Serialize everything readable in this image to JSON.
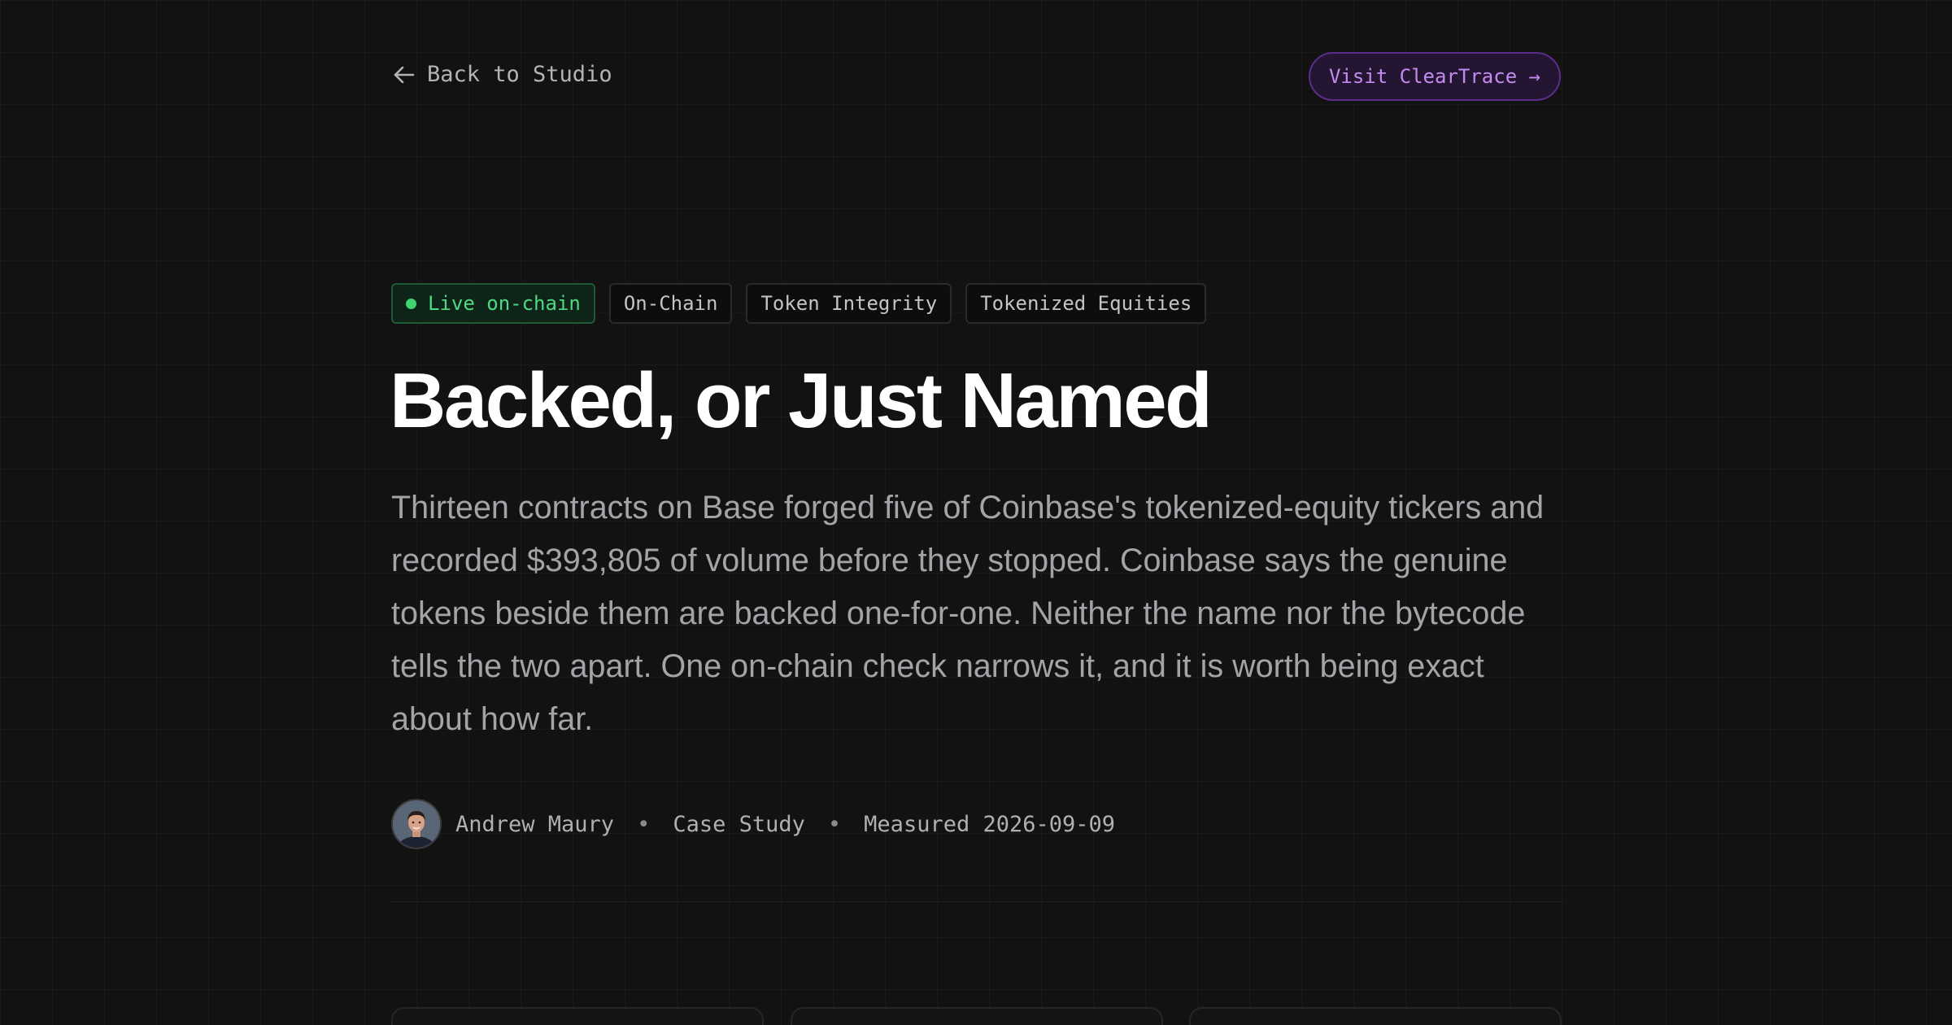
{
  "nav": {
    "back_label": "Back to Studio",
    "visit_label": "Visit ClearTrace →"
  },
  "tags": [
    {
      "label": "Live on-chain",
      "status": "live",
      "color": "#4ed982"
    },
    {
      "label": "On-Chain"
    },
    {
      "label": "Token Integrity"
    },
    {
      "label": "Tokenized Equities"
    }
  ],
  "article": {
    "title": "Backed, or Just Named",
    "lead": "Thirteen contracts on Base forged five of Coinbase's tokenized-equity tickers and recorded $393,805 of volume before they stopped. Coinbase says the genuine tokens beside them are backed one-for-one. Neither the name nor the bytecode tells the two apart. One on-chain check narrows it, and it is worth being exact about how far."
  },
  "byline": {
    "author": "Andrew Maury",
    "separator": "•",
    "type": "Case Study",
    "measured": "Measured 2026-09-09"
  },
  "colors": {
    "background": "#121212",
    "accent_purple": "#c38bf0",
    "live_green": "#4ed982"
  },
  "icons": {
    "back": "arrow-left-icon",
    "live": "status-dot-icon"
  }
}
